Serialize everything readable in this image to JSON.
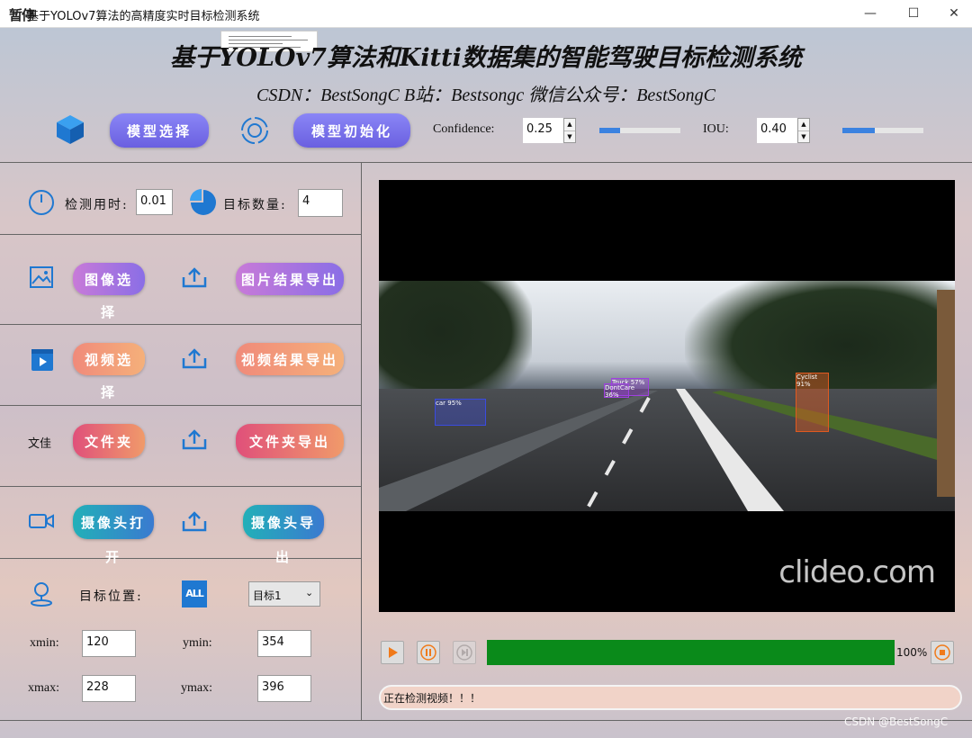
{
  "window": {
    "icon_text": "暂停",
    "title": "基于YOLOv7算法的高精度实时目标检测系统",
    "minimize": "—",
    "maximize": "☐",
    "close": "✕"
  },
  "header": {
    "title": "基于YOLOv7算法和Kitti数据集的智能驾驶目标检测系统",
    "subtitle": "CSDN：BestSongC   B站：Bestsongc   微信公众号：BestSongC"
  },
  "toolbar": {
    "model_select_label": "模型选择",
    "model_init_label": "模型初始化",
    "confidence_label": "Confidence:",
    "confidence_value": "0.25",
    "confidence_level": 0.25,
    "iou_label": "IOU:",
    "iou_value": "0.40",
    "iou_level": 0.4
  },
  "stats": {
    "time_label": "检测用时:",
    "time_value": "0.01",
    "count_label": "目标数量:",
    "count_value": "4"
  },
  "actions": {
    "image_select": "图像选择",
    "image_export": "图片结果导出",
    "video_select": "视频选择",
    "video_export": "视频结果导出",
    "folder_icon_text": "文佳",
    "folder_select": "文件夹",
    "folder_export": "文件夹导出",
    "camera_open": "摄像头打开",
    "camera_export": "摄像头导出"
  },
  "target": {
    "position_label": "目标位置:",
    "all_icon_text": "ALL",
    "selected": "目标1",
    "xmin_label": "xmin:",
    "xmin_value": "120",
    "ymin_label": "ymin:",
    "ymin_value": "354",
    "xmax_label": "xmax:",
    "xmax_value": "228",
    "ymax_label": "ymax:",
    "ymax_value": "396"
  },
  "video": {
    "watermark": "clideo.com",
    "detections": [
      {
        "label": "car 95%",
        "color": "#3a4be0"
      },
      {
        "label": "Truck 57%",
        "color": "#a040e0"
      },
      {
        "label": "DontCare 36%",
        "color": "#a040e0"
      },
      {
        "label": "Cyclist 91%",
        "color": "#e05a20"
      }
    ]
  },
  "player": {
    "progress_fraction": 1.0,
    "progress_text": "100%",
    "status": "正在检测视频！！！"
  },
  "footer": {
    "credit": "CSDN @BestSongC"
  },
  "colors": {
    "accent_blue": "#1f78d1",
    "progress_green": "#0a8a1a",
    "play_orange": "#f07a1a"
  }
}
